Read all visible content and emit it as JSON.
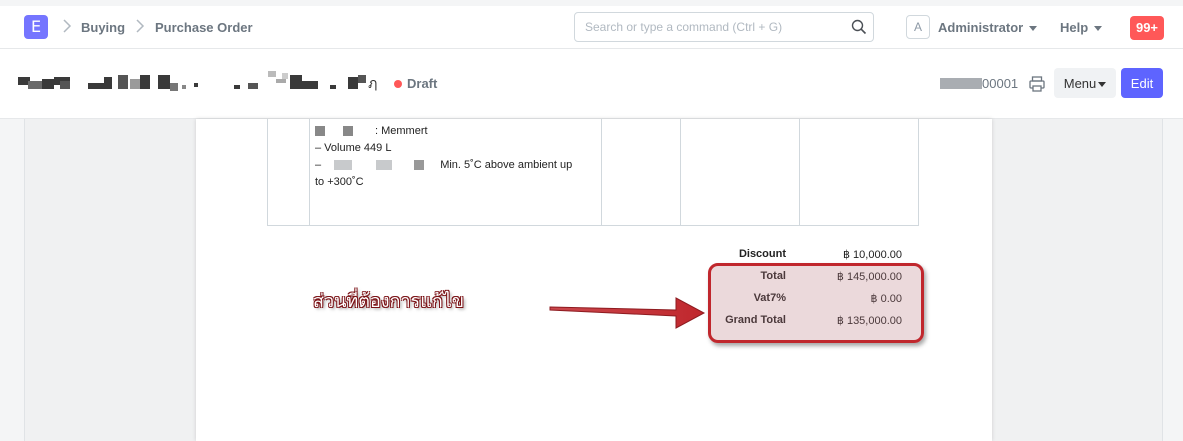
{
  "nav": {
    "logo_letter": "E",
    "breadcrumbs": [
      "Buying",
      "Purchase Order"
    ],
    "search_placeholder": "Search or type a command (Ctrl + G)",
    "user_initial": "A",
    "user_label": "Administrator",
    "help_label": "Help",
    "notification_count": "99+"
  },
  "header": {
    "status": "Draft",
    "doc_name_suffix": "00001",
    "menu_label": "Menu",
    "edit_label": "Edit"
  },
  "item": {
    "brand_suffix": ": Memmert",
    "volume": "– Volume 449 L",
    "temp_prefix": "–",
    "temp_text": "Min. 5˚C above ambient up",
    "temp_cont": "to +300˚C"
  },
  "totals": [
    {
      "label": "Discount",
      "value": "฿ 10,000.00"
    },
    {
      "label": "Total",
      "value": "฿ 145,000.00"
    },
    {
      "label": "Vat7%",
      "value": "฿ 0.00"
    },
    {
      "label": "Grand Total",
      "value": "฿ 135,000.00"
    }
  ],
  "annotation": {
    "text": "ส่วนที่ต้องการแก้ไข",
    "color": "#c0272d"
  }
}
